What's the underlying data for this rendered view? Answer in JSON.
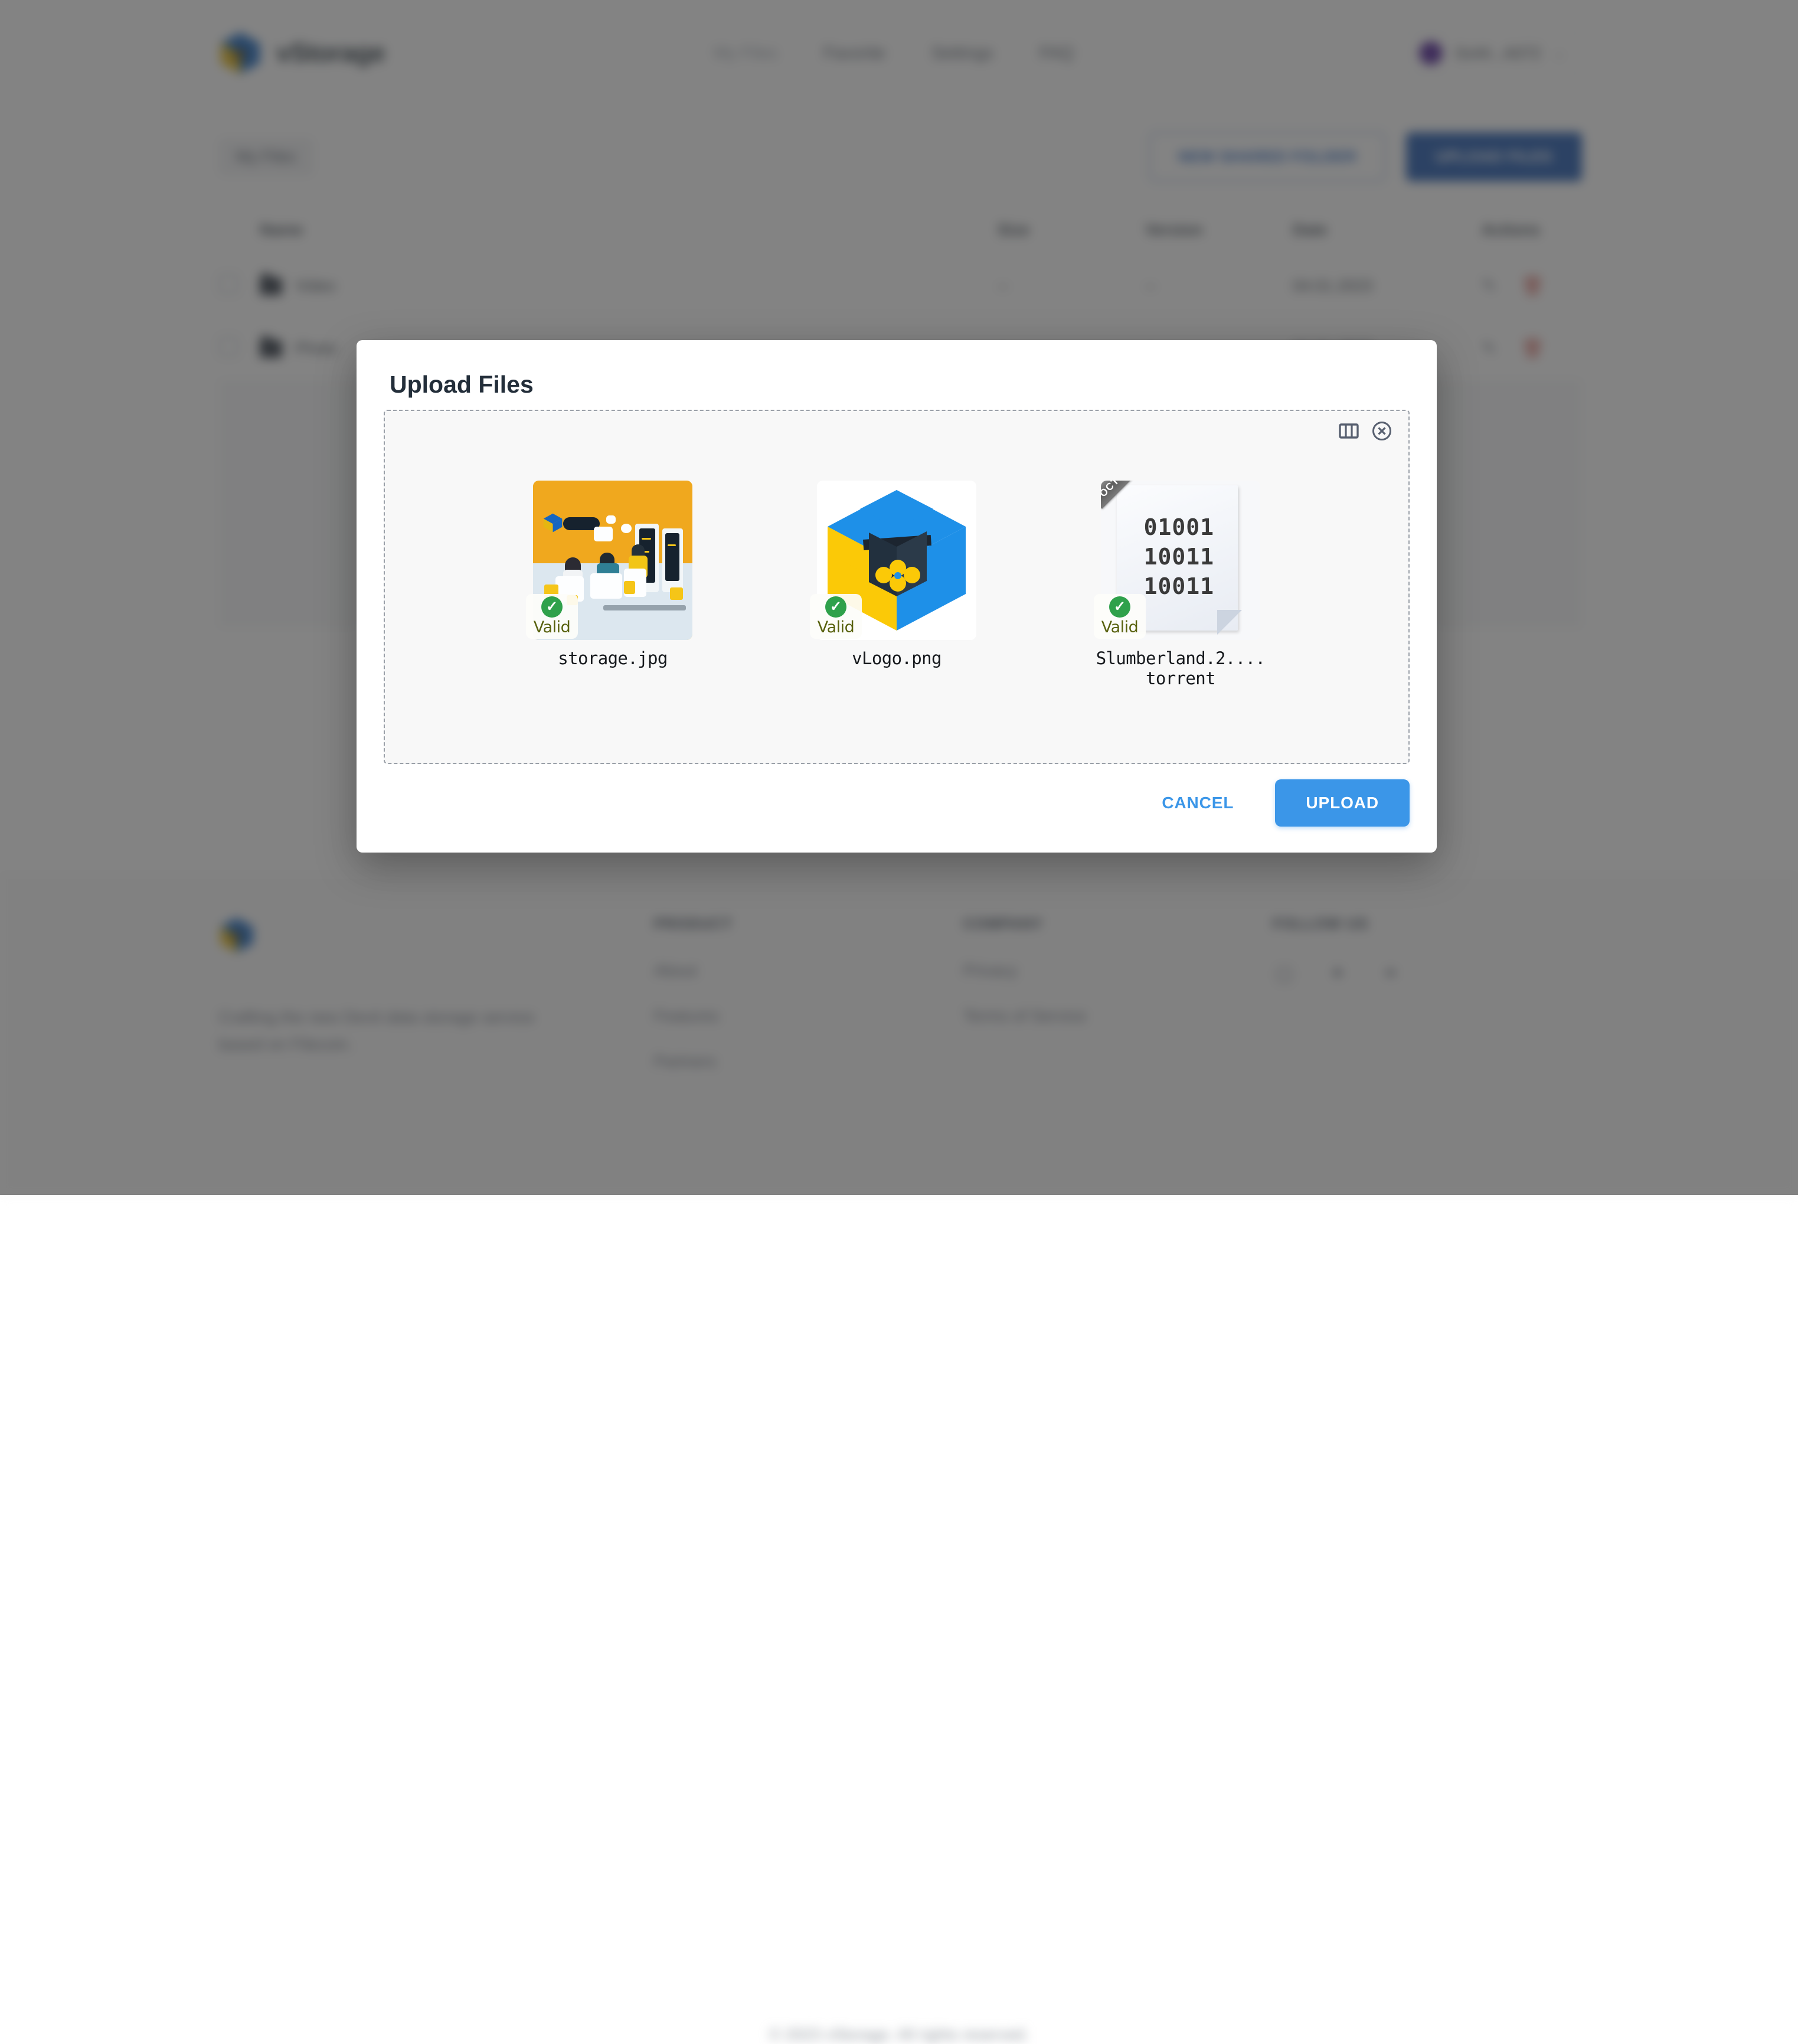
{
  "header": {
    "brand": "vStorage",
    "brand_logo_icon": "cube-logo-icon",
    "nav": [
      {
        "label": "My Files",
        "active": true
      },
      {
        "label": "Favorite",
        "active": false
      },
      {
        "label": "Settings",
        "active": false
      },
      {
        "label": "FAQ",
        "active": false
      }
    ],
    "user": {
      "name": "0x44...A072",
      "avatar_color": "#4c1d95",
      "chevron": "⌄"
    }
  },
  "main": {
    "breadcrumb": "My Files",
    "new_folder_button": "NEW SHARED FOLDER",
    "upload_button": "UPLOAD FILES",
    "table": {
      "columns": [
        "",
        "Name",
        "Size",
        "Version",
        "Date",
        "Actions"
      ],
      "rows": [
        {
          "name": "Video",
          "size": "--",
          "version": "--",
          "date": "04.01.2023",
          "edit_icon": "pencil-icon",
          "delete_icon": "trash-icon"
        },
        {
          "name": "Photo",
          "size": "--",
          "version": "--",
          "date": "04.01.2023",
          "edit_icon": "pencil-icon",
          "delete_icon": "trash-icon"
        }
      ]
    }
  },
  "modal": {
    "title": "Upload Files",
    "grid_view_icon": "columns-view-icon",
    "clear_all_icon": "close-circle-icon",
    "files": [
      {
        "name": "storage.jpg",
        "badge": "Valid",
        "badge_icon": "check-circle-icon",
        "thumb_kind": "image-illustration"
      },
      {
        "name": "vLogo.png",
        "badge": "Valid",
        "badge_icon": "check-circle-icon",
        "thumb_kind": "image-cube-logo"
      },
      {
        "name": "Slumberland.2....torrent",
        "badge": "Valid",
        "badge_icon": "check-circle-icon",
        "thumb_kind": "binary-document",
        "ribbon_label": "OCTET-STREAM",
        "binary_lines": [
          "01001",
          "10011",
          "10011"
        ]
      }
    ],
    "cancel_button": "CANCEL",
    "upload_button": "UPLOAD",
    "accent_color": "#3b96e8",
    "valid_color": "#2fa14b"
  },
  "footer": {
    "tagline": "Crafting the new Devit data storage service based on Filecoin.",
    "columns": [
      {
        "heading": "PRODUCT",
        "links": [
          "About",
          "Features",
          "Partners"
        ]
      },
      {
        "heading": "COMPANY",
        "links": [
          "Privacy",
          "Terms of Service"
        ]
      }
    ],
    "follow_heading": "FOLLOW US",
    "socials": [
      "instagram-icon",
      "twitter-icon",
      "telegram-icon"
    ],
    "copyright": "© 2023 vStorage. All rights reserved."
  }
}
